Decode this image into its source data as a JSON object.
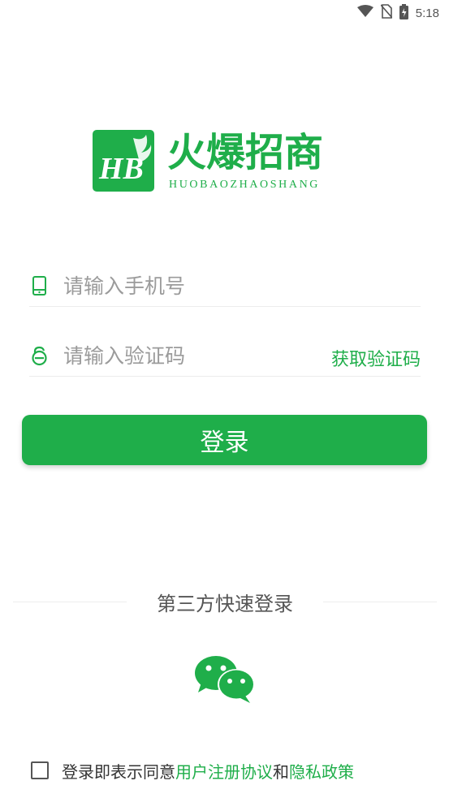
{
  "status_bar": {
    "time": "5:18",
    "icons": [
      "wifi-icon",
      "no-sim-icon",
      "battery-charging-icon"
    ]
  },
  "logo": {
    "mark": "HB",
    "title": "火爆招商",
    "subtitle": "HUOBAOZHAOSHANG"
  },
  "form": {
    "phone_placeholder": "请输入手机号",
    "code_placeholder": "请输入验证码",
    "get_code_label": "获取验证码",
    "login_label": "登录"
  },
  "third_party": {
    "label": "第三方快速登录",
    "options": [
      "wechat-icon"
    ]
  },
  "agreement": {
    "prefix": "登录即表示同意",
    "user_agreement": "用户注册协议",
    "conjunction": "和",
    "privacy_policy": "隐私政策",
    "checked": false
  },
  "colors": {
    "brand_green": "#1fae4a",
    "placeholder_gray": "#9b9b9b"
  }
}
